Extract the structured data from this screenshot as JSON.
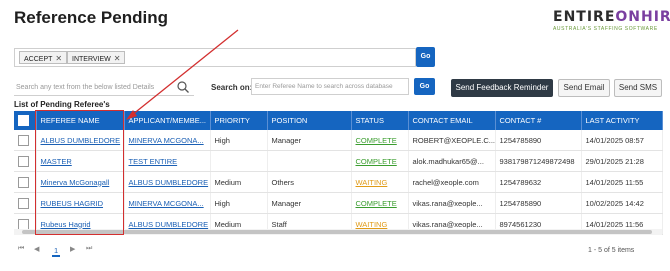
{
  "page": {
    "title": "Reference Pending"
  },
  "logo": {
    "brand_a": "ENTIRE",
    "brand_b": "ONHIRE",
    "tagline": "AUSTRALIA'S STAFFING SOFTWARE"
  },
  "filters": {
    "chips": [
      {
        "label": "ACCEPT",
        "remove": "✕"
      },
      {
        "label": "INTERVIEW",
        "remove": "✕"
      }
    ],
    "go_label": "Go"
  },
  "search": {
    "placeholder": "Search any text from the below listed Details",
    "search_on_label": "Search on:",
    "referee_placeholder": "Enter Referee Name to search across database",
    "go_label": "Go"
  },
  "actions": {
    "feedback": "Send Feedback Reminder",
    "email": "Send Email",
    "sms": "Send SMS"
  },
  "list_label": "List of Pending Referee's",
  "table": {
    "headers": [
      "REFEREE NAME",
      "APPLICANT/MEMBE...",
      "PRIORITY",
      "POSITION",
      "STATUS",
      "CONTACT EMAIL",
      "CONTACT #",
      "LAST ACTIVITY"
    ],
    "rows": [
      {
        "referee": "ALBUS DUMBLEDORE",
        "applicant": "MINERVA MCGONA...",
        "priority": "High",
        "position": "Manager",
        "status": "COMPLETE",
        "email": "ROBERT@XEOPLE.C...",
        "contact": "1254785890",
        "activity": "14/01/2025 08:57"
      },
      {
        "referee": "MASTER",
        "applicant": "TEST ENTIRE",
        "priority": "",
        "position": "",
        "status": "COMPLETE",
        "email": "alok.madhukar65@...",
        "contact": "938179871249872498",
        "activity": "29/01/2025 21:28"
      },
      {
        "referee": "Minerva McGonagall",
        "applicant": "ALBUS DUMBLEDORE",
        "priority": "Medium",
        "position": "Others",
        "status": "WAITING",
        "email": "rachel@xeople.com",
        "contact": "1254789632",
        "activity": "14/01/2025 11:55"
      },
      {
        "referee": "RUBEUS HAGRID",
        "applicant": "MINERVA MCGONA...",
        "priority": "High",
        "position": "Manager",
        "status": "COMPLETE",
        "email": "vikas.rana@xeople...",
        "contact": "1254785890",
        "activity": "10/02/2025 14:42"
      },
      {
        "referee": "Rubeus Hagrid",
        "applicant": "ALBUS DUMBLEDORE",
        "priority": "Medium",
        "position": "Staff",
        "status": "WAITING",
        "email": "vikas.rana@xeople...",
        "contact": "8974561230",
        "activity": "14/01/2025 11:56"
      }
    ]
  },
  "pagination": {
    "first": "⏮",
    "prev": "◀",
    "page": "1",
    "next": "▶",
    "last": "⏭",
    "items": "1 - 5 of 5 items"
  },
  "colors": {
    "header_blue": "#1565c0",
    "complete": "#3a9d2e",
    "waiting": "#e09b18",
    "annotation_red": "#d32f2f"
  }
}
